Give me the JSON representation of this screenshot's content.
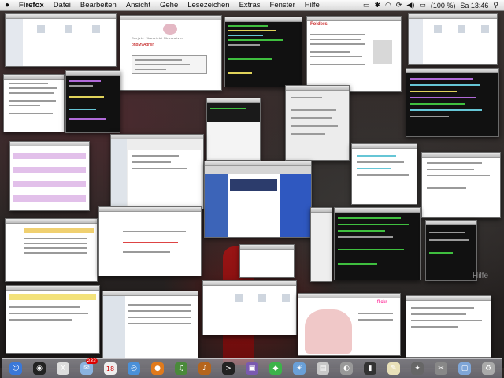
{
  "menubar": {
    "apple": "",
    "app_name": "Firefox",
    "items": [
      "Datei",
      "Bearbeiten",
      "Ansicht",
      "Gehe",
      "Lesezeichen",
      "Extras",
      "Fenster",
      "Hilfe"
    ],
    "battery": "(100 %)",
    "clock": "Sa 13:46"
  },
  "windows": {
    "phpmyadmin_title": "phpMyAdmin",
    "phpmyadmin_subtitle": "Projekt-Übersicht Übersetzen",
    "blog_title": "Folders",
    "flickr_logo": "flickr"
  },
  "desktop": {
    "ghost_text": "Hilfe"
  },
  "dock": {
    "items": [
      {
        "name": "finder-icon",
        "glyph": "☺",
        "color": "#3a78d8"
      },
      {
        "name": "dashboard-icon",
        "glyph": "◉",
        "color": "#222"
      },
      {
        "name": "x11-icon",
        "glyph": "X",
        "color": "#ddd"
      },
      {
        "name": "mail-icon",
        "glyph": "✉",
        "color": "#8ab3e0"
      },
      {
        "name": "ical-icon",
        "glyph": "18",
        "color": "#eee"
      },
      {
        "name": "safari-icon",
        "glyph": "◎",
        "color": "#4a90d8"
      },
      {
        "name": "firefox-icon",
        "glyph": "●",
        "color": "#e07a1c"
      },
      {
        "name": "itunes-icon",
        "glyph": "♫",
        "color": "#4a8a3a"
      },
      {
        "name": "guitar-icon",
        "glyph": "♪",
        "color": "#b5651d"
      },
      {
        "name": "terminal-icon",
        "glyph": ">",
        "color": "#222"
      },
      {
        "name": "photo-icon",
        "glyph": "▣",
        "color": "#7a5ab0"
      },
      {
        "name": "adium-icon",
        "glyph": "◆",
        "color": "#3cb34a"
      },
      {
        "name": "iphoto-icon",
        "glyph": "☀",
        "color": "#6aa0d8"
      },
      {
        "name": "preview-icon",
        "glyph": "▤",
        "color": "#c8c8c8"
      },
      {
        "name": "disk-icon",
        "glyph": "◐",
        "color": "#999"
      },
      {
        "name": "console-icon",
        "glyph": "▮",
        "color": "#333"
      },
      {
        "name": "textedit-icon",
        "glyph": "✎",
        "color": "#e8e0b8"
      },
      {
        "name": "script-icon",
        "glyph": "✦",
        "color": "#666"
      },
      {
        "name": "tools-icon",
        "glyph": "✂",
        "color": "#888"
      },
      {
        "name": "folder-icon",
        "glyph": "▢",
        "color": "#7fa6d8"
      },
      {
        "name": "trash-icon",
        "glyph": "♻",
        "color": "#aaa"
      }
    ],
    "ical_badge": "233"
  }
}
